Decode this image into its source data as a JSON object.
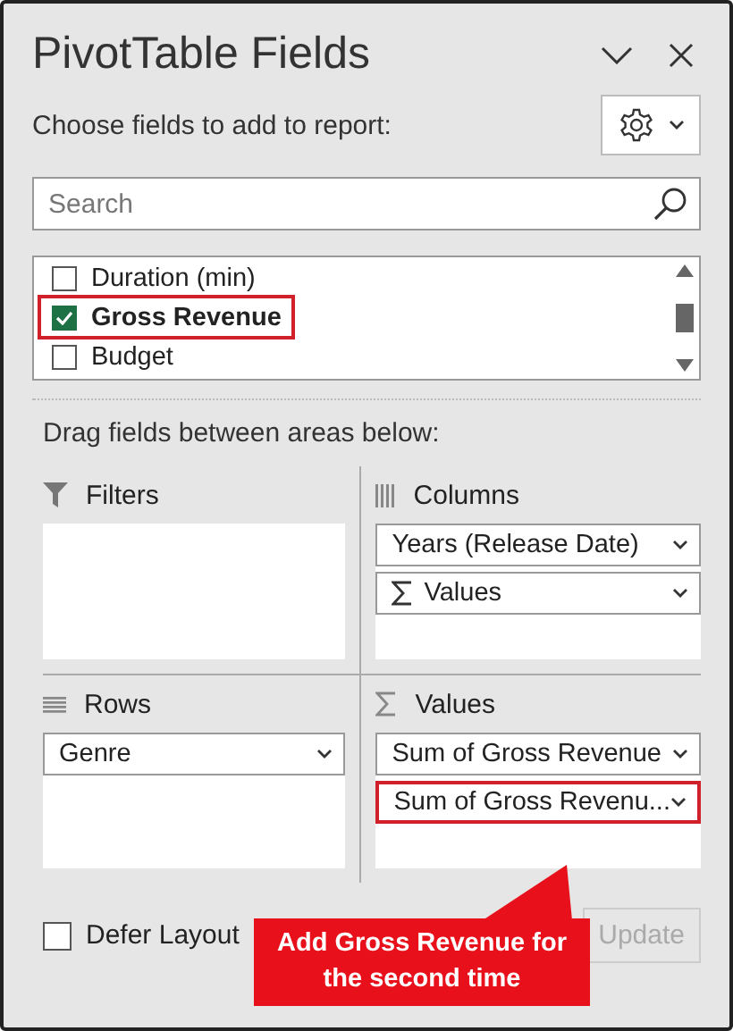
{
  "panel": {
    "title": "PivotTable Fields",
    "subtitle": "Choose fields to add to report:"
  },
  "search": {
    "placeholder": "Search"
  },
  "fields": [
    {
      "label": "Duration (min)",
      "checked": false,
      "highlighted": false
    },
    {
      "label": "Gross Revenue",
      "checked": true,
      "highlighted": true
    },
    {
      "label": "Budget",
      "checked": false,
      "highlighted": false
    }
  ],
  "areas_caption": "Drag fields between areas below:",
  "areas": [
    {
      "kind": "filters",
      "label": "Filters"
    },
    {
      "kind": "columns",
      "label": "Columns",
      "items": [
        {
          "label": "Years (Release Date)",
          "sigma": false,
          "highlighted": false
        },
        {
          "label": "Values",
          "sigma": true,
          "highlighted": false
        }
      ]
    },
    {
      "kind": "rows",
      "label": "Rows",
      "items": [
        {
          "label": "Genre",
          "sigma": false,
          "highlighted": false
        }
      ]
    },
    {
      "kind": "values",
      "label": "Values",
      "items": [
        {
          "label": "Sum of Gross Revenue",
          "sigma": false,
          "highlighted": false
        },
        {
          "label": "Sum of Gross Revenu...",
          "sigma": false,
          "highlighted": true
        }
      ]
    }
  ],
  "defer": {
    "label": "Defer Layout",
    "checked": false
  },
  "update_button": {
    "label": "Update",
    "disabled": true
  },
  "callout": {
    "text": "Add Gross Revenue for the second time"
  }
}
